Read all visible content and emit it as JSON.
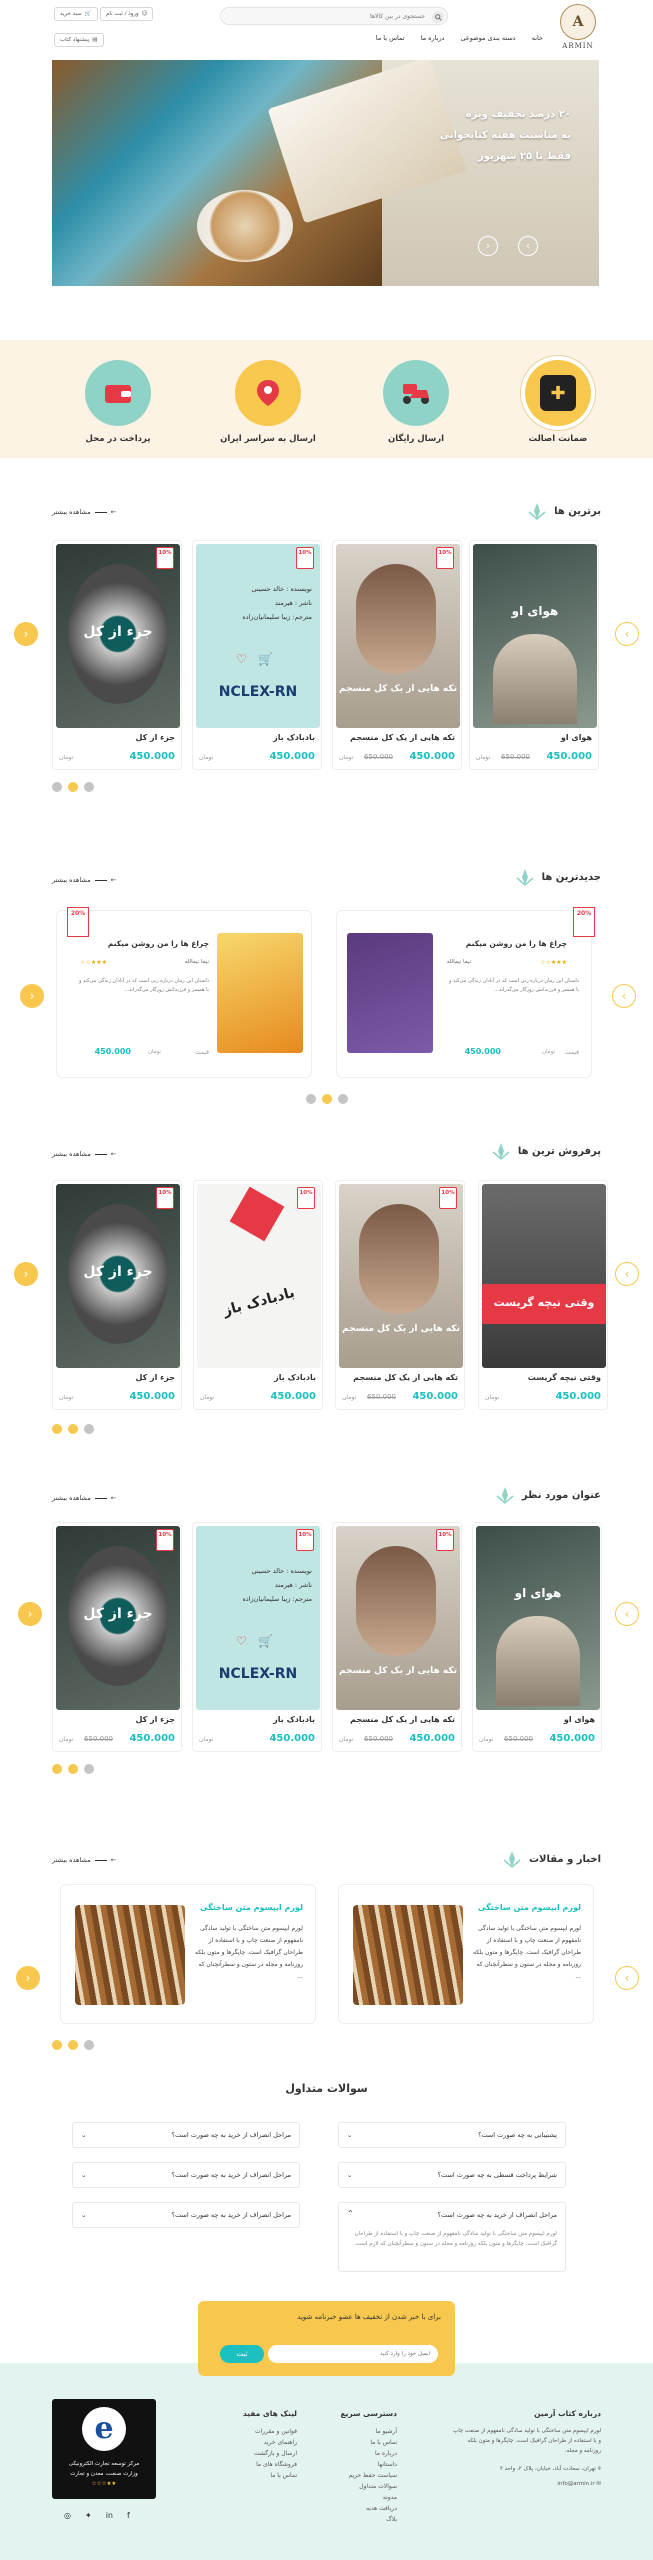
{
  "header": {
    "logo_text": "ARMIN",
    "search_placeholder": "جستجوی در بین کالاها",
    "nav": [
      "خانه",
      "دسته بندی موضوعی",
      "درباره ما",
      "تماس با ما"
    ],
    "login_label": "ورود / ثبت نام",
    "cart_label": "سبد خرید",
    "suggest_label": "پیشنهاد کتاب",
    "colors": {
      "accent": "#f7c84d",
      "teal": "#1cc0c0",
      "badge": "#e63946"
    }
  },
  "hero": {
    "line1": "۲۰ درصد تخفیف ویژه",
    "line2": "به مناسبت هفته کتابخوانی",
    "line3": "فقط تا ۲۵ شهریور"
  },
  "features": [
    {
      "title": "ضمانت اصالت",
      "icon": "gift-icon",
      "color": "#f7c84d"
    },
    {
      "title": "ارسال رایگان",
      "icon": "delivery-icon",
      "color": "#8fd3c7"
    },
    {
      "title": "ارسال به سراسر ایران",
      "icon": "map-pin-icon",
      "color": "#f7c84d"
    },
    {
      "title": "پرداخت در محل",
      "icon": "wallet-icon",
      "color": "#8fd3c7"
    }
  ],
  "more_label": "مشاهده بیشتر",
  "sections": {
    "top": {
      "title": "برترین ها",
      "items": [
        {
          "title": "هوای او",
          "cover_text": "هوای او",
          "price": "450.000",
          "old": "650.000",
          "currency": "تومان",
          "discount": "10"
        },
        {
          "title": "تکه هایی از یک کل منسجم",
          "cover_text": "تکه هایی از یک کل منسجم",
          "price": "450.000",
          "old": "650.000",
          "currency": "تومان",
          "discount": "10"
        },
        {
          "title": "بادبادک باز",
          "cover_text": "NCLEX-RN",
          "price": "450.000",
          "old": "",
          "currency": "تومان",
          "discount": "10"
        },
        {
          "title": "جزء از کل",
          "cover_text": "جزء از کل",
          "price": "450.000",
          "old": "",
          "currency": "تومان",
          "discount": "10"
        }
      ],
      "hover": {
        "author_label": "نویسنده",
        "author": "خالد حسینی",
        "publisher_label": "ناشر",
        "publisher": "هیرمند",
        "translator": "مترجم: زیبا سلیمانیان‌زاده"
      }
    },
    "newest": {
      "title": "جدیدترین ها",
      "items": [
        {
          "title": "چراغ ها را من روشن میکنم",
          "author": "نیما نیمالله",
          "desc": "داستان این رمان درباره زنی است که در آبادان زندگی می‌کند و با همسر و فرزندانش روزگار می‌گذراند...",
          "price": "450.000",
          "price_label": "قیمت",
          "currency": "تومان",
          "rating": 3,
          "discount": "20"
        },
        {
          "title": "چراغ ها را من روشن میکنم",
          "author": "نیما نیمالله",
          "desc": "داستان این رمان درباره زنی است که در آبادان زندگی می‌کند و با همسر و فرزندانش روزگار می‌گذراند...",
          "price": "450.000",
          "price_label": "قیمت",
          "currency": "تومان",
          "rating": 3,
          "discount": "20"
        }
      ]
    },
    "bestseller": {
      "title": "پرفروش ترین ها",
      "items": [
        {
          "title": "وقتی نیچه گریست",
          "cover_text": "وقتی نیچه گریست",
          "price": "450.000",
          "old": "",
          "currency": "تومان",
          "discount": ""
        },
        {
          "title": "تکه هایی از یک کل منسجم",
          "cover_text": "تکه هایی از یک کل منسجم",
          "price": "450.000",
          "old": "650.000",
          "currency": "تومان",
          "discount": "10"
        },
        {
          "title": "بادبادک باز",
          "cover_text": "بادبادک باز",
          "price": "450.000",
          "old": "",
          "currency": "تومان",
          "discount": "10"
        },
        {
          "title": "جزء از کل",
          "cover_text": "جزء از کل",
          "price": "450.000",
          "old": "",
          "currency": "تومان",
          "discount": "10"
        }
      ]
    },
    "featured": {
      "title": "عنوان مورد نظر",
      "items": [
        {
          "title": "هوای او",
          "cover_text": "هوای او",
          "price": "450.000",
          "old": "650.000",
          "currency": "تومان",
          "discount": ""
        },
        {
          "title": "تکه هایی از یک کل منسجم",
          "cover_text": "تکه هایی از یک کل منسجم",
          "price": "450.000",
          "old": "650.000",
          "currency": "تومان",
          "discount": "10"
        },
        {
          "title": "بادبادک باز",
          "cover_text": "NCLEX-RN",
          "price": "450.000",
          "old": "",
          "currency": "تومان",
          "discount": "10"
        },
        {
          "title": "جزء از کل",
          "cover_text": "جزء از کل",
          "price": "450.000",
          "old": "650.000",
          "currency": "تومان",
          "discount": "10"
        }
      ]
    },
    "articles": {
      "title": "اخبار و مقالات",
      "items": [
        {
          "title": "لورم ایپسوم متن ساختگی",
          "body": "لورم ایپسوم متن ساختگی با تولید سادگی نامفهوم از صنعت چاپ و با استفاده از طراحان گرافیک است. چاپگرها و متون بلکه روزنامه و مجله در ستون و سطرآنچنان که ..."
        },
        {
          "title": "لورم ایپسوم متن ساختگی",
          "body": "لورم ایپسوم متن ساختگی با تولید سادگی نامفهوم از صنعت چاپ و با استفاده از طراحان گرافیک است. چاپگرها و متون بلکه روزنامه و مجله در ستون و سطرآنچنان که ..."
        }
      ]
    }
  },
  "faq": {
    "title": "سوالات متداول",
    "right": [
      "پشتیبانی به چه صورت است؟",
      "شرایط پرداخت قسطی به چه صورت است؟",
      "مراحل انصراف از خرید به چه صورت است؟"
    ],
    "left": [
      "مراحل انصراف از خرید به چه صورت است؟",
      "مراحل انصراف از خرید به چه صورت است؟",
      "مراحل انصراف از خرید به چه صورت است؟"
    ],
    "open_answer": "لورم ایپسوم متن ساختگی با تولید سادگی نامفهوم از صنعت چاپ و با استفاده از طراحان گرافیک است. چاپگرها و متون بلکه روزنامه و مجله در ستون و سطرآنچنان که لازم است."
  },
  "newsletter": {
    "text": "برای با خبر شدن از تخفیف ها عضو خبرنامه شوید",
    "placeholder": "ایمیل خود را وارد کنید",
    "button": "ثبت"
  },
  "footer": {
    "about_title": "درباره کتاب آرمین",
    "about_text": "لورم ایپسوم متن ساختگی با تولید سادگی نامفهوم از صنعت چاپ و با استفاده از طراحان گرافیک است. چاپگرها و متون بلکه روزنامه و مجله.",
    "address": "تهران، سعادت آباد، خیابان، پلاک ۲، واحد ۴",
    "email": "info@armin.ir",
    "quick_title": "دسترسی سریع",
    "quick": [
      "آرشیو ما",
      "تماس با ما",
      "درباره ما",
      "داستانها",
      "سیاست حفظ حریم",
      "سوالات متداول",
      "مدونه",
      "دریافت هدیه",
      "بلاگ"
    ],
    "useful_title": "لینک های مفید",
    "useful": [
      "قوانین و مقررات",
      "راهنمای خرید",
      "ارسال و بازگشت",
      "فروشگاه های ما",
      "تماس با ما"
    ],
    "enamad_line1": "مرکز توسعه تجارت الکترونیکی",
    "enamad_line2": "وزارت صنعت، معدن و تجارت",
    "social": [
      "facebook-icon",
      "linkedin-icon",
      "twitter-icon",
      "instagram-icon"
    ]
  }
}
